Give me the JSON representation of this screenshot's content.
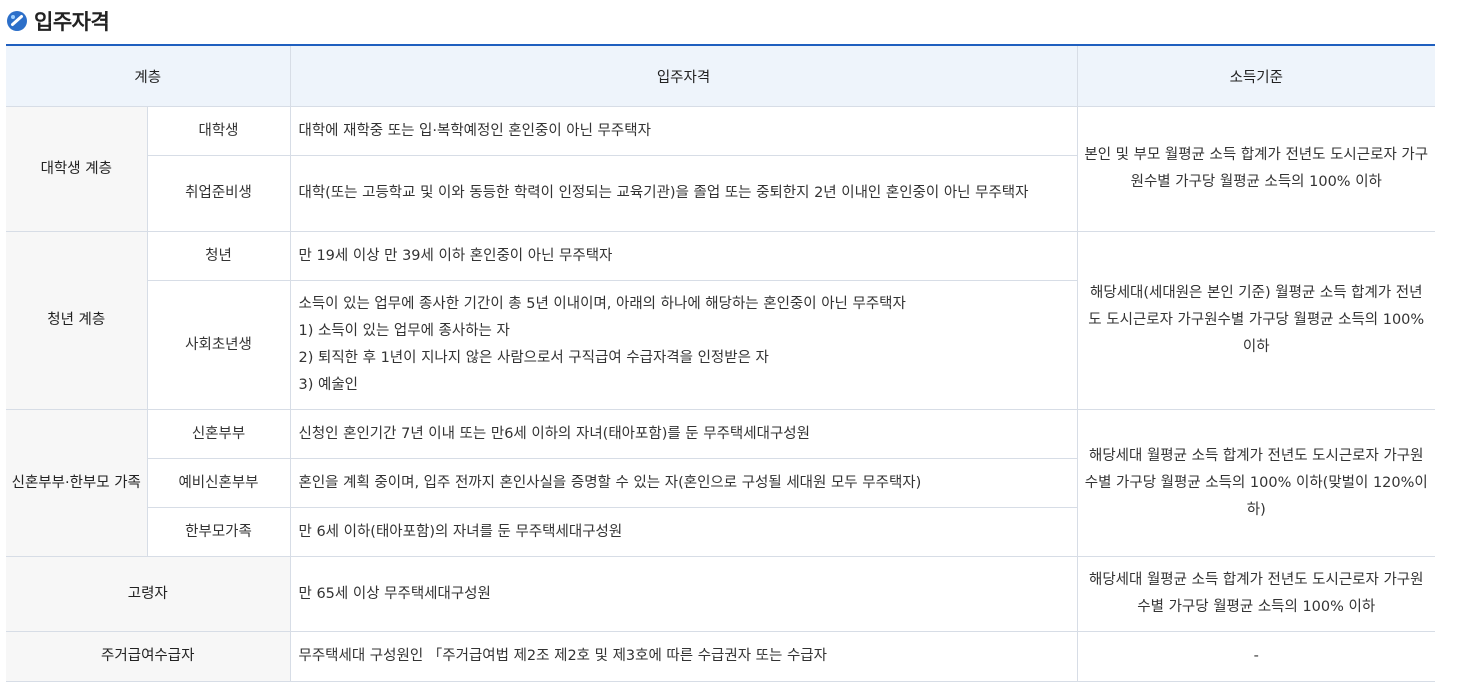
{
  "section": {
    "title": "입주자격"
  },
  "colors": {
    "accent": "#1f5fbf",
    "header_bg": "#eef4fb",
    "group_bg": "#f7f7f7"
  },
  "icons": {
    "title": "circle-link-icon"
  },
  "table": {
    "headers": {
      "tier": "계층",
      "qualification": "입주자격",
      "income": "소득기준"
    },
    "groups": {
      "student": {
        "label": "대학생 계층",
        "r1": {
          "sub": "대학생",
          "text": "대학에 재학중 또는 입·복학예정인 혼인중이 아닌 무주택자"
        },
        "r2": {
          "sub": "취업준비생",
          "text": "대학(또는 고등학교 및 이와 동등한 학력이 인정되는 교육기관)을 졸업 또는 중퇴한지 2년 이내인 혼인중이 아닌 무주택자"
        },
        "income": "본인 및 부모 월평균 소득 합계가 전년도 도시근로자 가구원수별 가구당 월평균 소득의 100% 이하"
      },
      "youth": {
        "label": "청년 계층",
        "r1": {
          "sub": "청년",
          "text": "만 19세 이상 만 39세 이하 혼인중이 아닌 무주택자"
        },
        "r2": {
          "sub": "사회초년생",
          "line1": "소득이 있는 업무에 종사한 기간이 총 5년 이내이며, 아래의 하나에 해당하는 혼인중이 아닌 무주택자",
          "line2": "1) 소득이 있는 업무에 종사하는 자",
          "line3": "2) 퇴직한 후 1년이 지나지 않은 사람으로서 구직급여 수급자격을 인정받은 자",
          "line4": "3) 예술인"
        },
        "income": "해당세대(세대원은 본인 기준) 월평균 소득 합계가 전년도 도시근로자 가구원수별 가구당 월평균 소득의 100% 이하"
      },
      "family": {
        "label": "신혼부부·한부모 가족",
        "r1": {
          "sub": "신혼부부",
          "text": "신청인 혼인기간 7년 이내 또는 만6세 이하의 자녀(태아포함)를 둔 무주택세대구성원"
        },
        "r2": {
          "sub": "예비신혼부부",
          "text": "혼인을 계획 중이며, 입주 전까지 혼인사실을 증명할 수 있는 자(혼인으로 구성될 세대원 모두 무주택자)"
        },
        "r3": {
          "sub": "한부모가족",
          "text": "만 6세 이하(태아포함)의 자녀를 둔 무주택세대구성원"
        },
        "income": "해당세대 월평균 소득 합계가 전년도 도시근로자 가구원수별 가구당 월평균 소득의 100% 이하(맞벌이 120%이하)"
      },
      "elderly": {
        "label": "고령자",
        "text": "만 65세 이상 무주택세대구성원",
        "income": "해당세대 월평균 소득 합계가 전년도 도시근로자 가구원수별 가구당 월평균 소득의 100% 이하"
      },
      "housing": {
        "label": "주거급여수급자",
        "text": "무주택세대 구성원인 「주거급여법 제2조 제2호 및 제3호에 따른 수급권자 또는 수급자",
        "income": "-"
      }
    }
  }
}
